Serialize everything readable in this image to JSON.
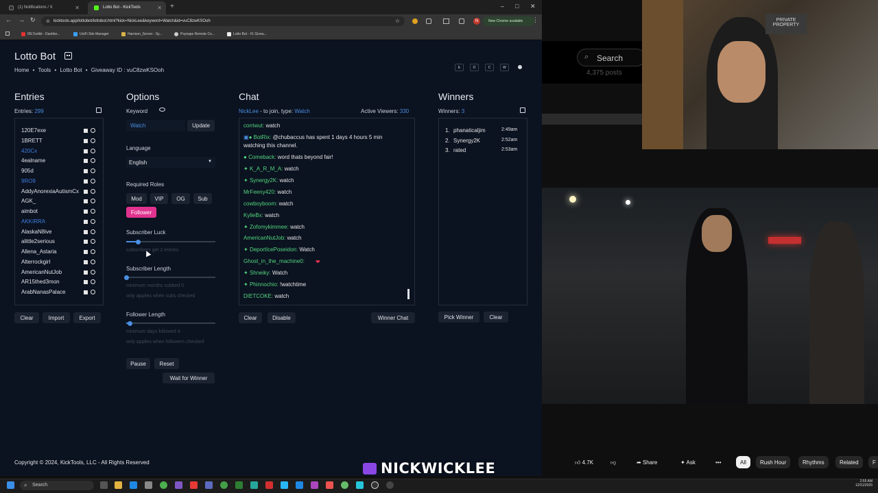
{
  "browser": {
    "tabs": [
      {
        "title": "(1) Notifications / X"
      },
      {
        "title": "Lotto Bot - KickTools"
      }
    ],
    "url": "kicktools.app/lottobot/lottobot.html?kick=NickLee&keyword=Watch&id=vuC8zwKSOoh",
    "update_label": "New Chrome available",
    "bookmarks": [
      "IRLToolkit - Dashbo...",
      "UniFi Site Manager",
      "Harrison_Server - Sy...",
      "Psynaps Remote Co...",
      "Lotto Bot - #1 Givea..."
    ]
  },
  "app": {
    "title": "Lotto Bot",
    "breadcrumb": {
      "home": "Home",
      "tools": "Tools",
      "current": "Lotto Bot",
      "giveaway_label": "Giveaway ID :",
      "giveaway_id": "vuC8zwKSOoh"
    },
    "header_controls": [
      "E",
      "O",
      "C",
      "W"
    ],
    "entries": {
      "heading": "Entries",
      "count_label": "Entries:",
      "count": "299",
      "items": [
        {
          "name": "120E7exe",
          "highlight": false
        },
        {
          "name": "1BRETT",
          "highlight": false
        },
        {
          "name": "420Cx",
          "highlight": true
        },
        {
          "name": "4ealname",
          "highlight": false
        },
        {
          "name": "905d",
          "highlight": false
        },
        {
          "name": "9RO9",
          "highlight": true
        },
        {
          "name": "AddyAnorexiaAutismCx",
          "highlight": false
        },
        {
          "name": "AGK_",
          "highlight": false
        },
        {
          "name": "aimbot",
          "highlight": false
        },
        {
          "name": "AKKIRRA",
          "highlight": true
        },
        {
          "name": "AlaskaN8ive",
          "highlight": false
        },
        {
          "name": "alittle2serious",
          "highlight": false
        },
        {
          "name": "Allena_Astaria",
          "highlight": false
        },
        {
          "name": "Alterrockgirl",
          "highlight": false
        },
        {
          "name": "AmericanNutJob",
          "highlight": false
        },
        {
          "name": "AR15thed3mon",
          "highlight": false
        },
        {
          "name": "ArabNanasPalace",
          "highlight": false
        }
      ],
      "buttons": {
        "clear": "Clear",
        "import": "Import",
        "export": "Export"
      }
    },
    "options": {
      "heading": "Options",
      "keyword_label": "Keyword",
      "keyword_value": "Watch",
      "update_button": "Update",
      "language_label": "Language",
      "language_value": "English",
      "roles_label": "Required Roles",
      "roles": [
        "Mod",
        "VIP",
        "OG",
        "Sub"
      ],
      "follower_role": "Follower",
      "sub_luck_label": "Subscriber Luck",
      "sub_luck_note": "subscribers get 2 entries",
      "sub_luck_value": 0.13,
      "sub_length_label": "Subscriber Length",
      "sub_length_note1": "minimum months subbed 0",
      "sub_length_note2": "only applies when subs checked",
      "sub_length_value": 0,
      "follower_length_label": "Follower Length",
      "follower_length_note1": "minimum days followed 4",
      "follower_length_note2": "only applies when followers checked",
      "follower_length_value": 0.04,
      "pause": "Pause",
      "reset": "Reset",
      "wait": "Wait for Winner"
    },
    "chat": {
      "heading": "Chat",
      "streamer": "NickLee",
      "join_text": "- to join, type:",
      "join_keyword": "Watch",
      "viewers_label": "Active Viewers:",
      "viewers": "330",
      "messages": [
        {
          "user": "corriwut:",
          "text": "watch",
          "badge": ""
        },
        {
          "user": "BotRix:",
          "text": "@chubaccus has spent 1 days 4 hours 5 min",
          "badge": "bot"
        },
        {
          "user": "",
          "text": "watching this channel.",
          "badge": ""
        },
        {
          "user": "Comeback:",
          "text": "word thats beyond fair!",
          "badge": "dot"
        },
        {
          "user": "K_A_R_M_A:",
          "text": "watch",
          "badge": "star"
        },
        {
          "user": "Synergy2K:",
          "text": "watch",
          "badge": "star"
        },
        {
          "user": "MrFeeny420:",
          "text": "watch",
          "badge": ""
        },
        {
          "user": "cowboyboom:",
          "text": "watch",
          "badge": ""
        },
        {
          "user": "KylieBx:",
          "text": "watch",
          "badge": ""
        },
        {
          "user": "Zofomykimmee:",
          "text": "watch",
          "badge": "star"
        },
        {
          "user": "AmericanNutJob:",
          "text": "watch",
          "badge": ""
        },
        {
          "user": "DeportIcePoseidon:",
          "text": "Watch",
          "badge": "star"
        },
        {
          "user": "Ghost_in_the_machine0:",
          "text": "",
          "badge": ""
        },
        {
          "user": "Shneiky:",
          "text": "Watch",
          "badge": "star"
        },
        {
          "user": "Phinnochio:",
          "text": "!watchtime",
          "badge": "star"
        },
        {
          "user": "DIETCOKE:",
          "text": "watch",
          "badge": ""
        }
      ],
      "buttons": {
        "clear": "Clear",
        "disable": "Disable",
        "winner_chat": "Winner Chat"
      }
    },
    "winners": {
      "heading": "Winners",
      "count_label": "Winners:",
      "count": "3",
      "list": [
        {
          "rank": "1.",
          "name": "phanaticaljim",
          "time": "2:49am"
        },
        {
          "rank": "2.",
          "name": "Synergy2K",
          "time": "2:52am"
        },
        {
          "rank": "3.",
          "name": "rated",
          "time": "2:53am"
        }
      ],
      "buttons": {
        "pick": "Pick Winner",
        "clear": "Clear"
      }
    },
    "footer": "Copyright © 2024, KickTools, LLC - All Rights Reserved"
  },
  "background": {
    "search_label": "Search",
    "posts": "4,375 posts",
    "yt_actions": {
      "likes": "4.7K",
      "share": "Share",
      "ask": "Ask"
    },
    "chips": [
      "All",
      "Rush Hour",
      "Rhythms",
      "Related",
      "F"
    ]
  },
  "overlay_name": "NICKWICKLEE",
  "taskbar": {
    "search": "Search",
    "time": "2:55 AM",
    "date": "12/31/2025"
  }
}
